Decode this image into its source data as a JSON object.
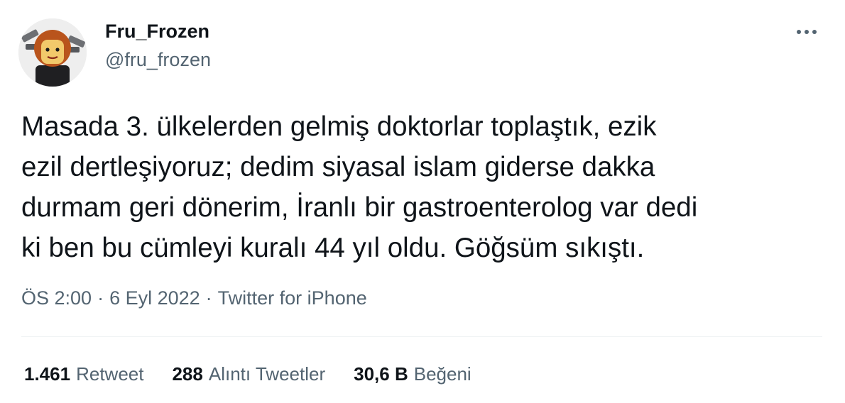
{
  "user": {
    "display_name": "Fru_Frozen",
    "handle": "@fru_frozen",
    "avatar_icon": "lego-figure-avatar"
  },
  "more_icon": "ellipsis-icon",
  "tweet": {
    "text": "Masada 3. ülkelerden gelmiş doktorlar toplaştık, ezik\nezil dertleşiyoruz;  dedim siyasal islam giderse dakka\ndurmam geri dönerim, İranlı bir gastroenterolog var dedi\nki ben bu cümleyi kuralı 44 yıl oldu. Göğsüm sıkıştı."
  },
  "meta": {
    "time": "ÖS 2:00",
    "date": "6 Eyl 2022",
    "source": "Twitter for iPhone",
    "separator": "·"
  },
  "stats": {
    "retweets_count": "1.461",
    "retweets_label": "Retweet",
    "quotes_count": "288",
    "quotes_label": "Alıntı Tweetler",
    "likes_count": "30,6 B",
    "likes_label": "Beğeni"
  },
  "colors": {
    "text_primary": "#0f1419",
    "text_secondary": "#536471",
    "divider": "#eff3f4"
  }
}
